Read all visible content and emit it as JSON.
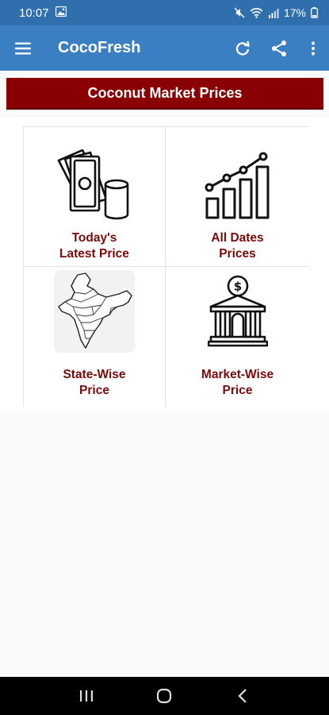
{
  "status": {
    "time": "10:07",
    "battery": "17%"
  },
  "app_bar": {
    "title": "CocoFresh"
  },
  "banner": {
    "text": "Coconut Market Prices"
  },
  "tiles": [
    {
      "line1": "Today's",
      "line2": "Latest Price",
      "icon": "money-coins-icon"
    },
    {
      "line1": "All Dates",
      "line2": "Prices",
      "icon": "bar-chart-icon"
    },
    {
      "line1": "State-Wise",
      "line2": "Price",
      "icon": "india-map-icon"
    },
    {
      "line1": "Market-Wise",
      "line2": "Price",
      "icon": "bank-building-icon"
    }
  ],
  "colors": {
    "status_bar": "#2f6fae",
    "app_bar": "#3a7fc2",
    "banner": "#8a0002",
    "tile_label": "#7a0a0a"
  }
}
